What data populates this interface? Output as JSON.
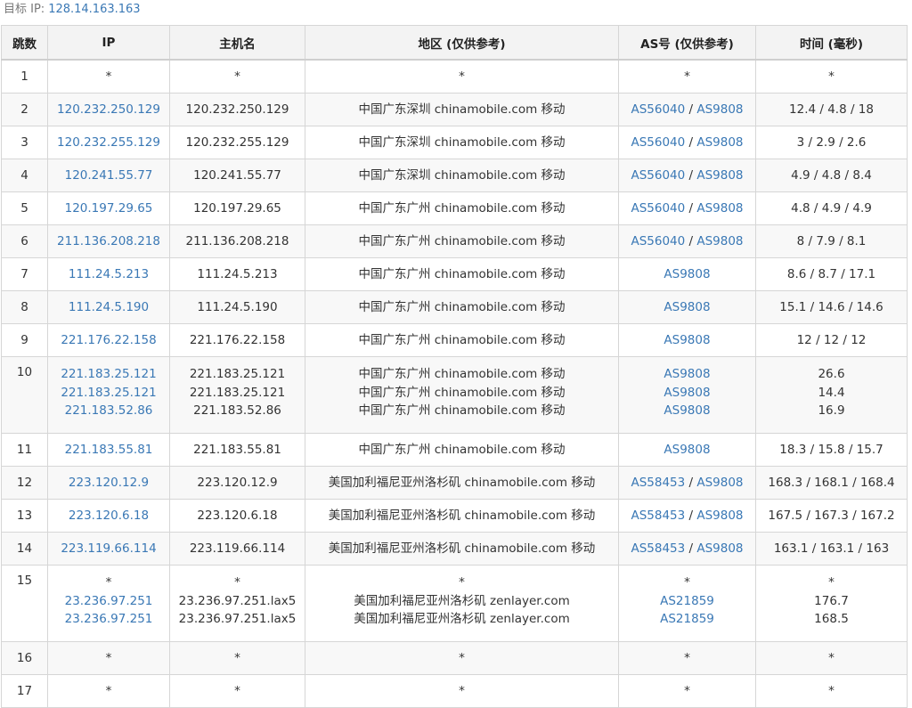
{
  "target": {
    "label": "目标 IP:",
    "ip": "128.14.163.163"
  },
  "columns": [
    "跳数",
    "IP",
    "主机名",
    "地区 (仅供参考)",
    "AS号 (仅供参考)",
    "时间 (毫秒)"
  ],
  "hops": [
    {
      "hop": "1",
      "ips": [
        "*"
      ],
      "hosts": [
        "*"
      ],
      "regions": [
        "*"
      ],
      "as": [
        [
          "*"
        ]
      ],
      "times": [
        "*"
      ]
    },
    {
      "hop": "2",
      "ips": [
        "120.232.250.129"
      ],
      "hosts": [
        "120.232.250.129"
      ],
      "regions": [
        "中国广东深圳 chinamobile.com 移动"
      ],
      "as": [
        [
          "AS56040",
          "AS9808"
        ]
      ],
      "times": [
        "12.4 / 4.8 / 18"
      ]
    },
    {
      "hop": "3",
      "ips": [
        "120.232.255.129"
      ],
      "hosts": [
        "120.232.255.129"
      ],
      "regions": [
        "中国广东深圳 chinamobile.com 移动"
      ],
      "as": [
        [
          "AS56040",
          "AS9808"
        ]
      ],
      "times": [
        "3 / 2.9 / 2.6"
      ]
    },
    {
      "hop": "4",
      "ips": [
        "120.241.55.77"
      ],
      "hosts": [
        "120.241.55.77"
      ],
      "regions": [
        "中国广东深圳 chinamobile.com 移动"
      ],
      "as": [
        [
          "AS56040",
          "AS9808"
        ]
      ],
      "times": [
        "4.9 / 4.8 / 8.4"
      ]
    },
    {
      "hop": "5",
      "ips": [
        "120.197.29.65"
      ],
      "hosts": [
        "120.197.29.65"
      ],
      "regions": [
        "中国广东广州 chinamobile.com 移动"
      ],
      "as": [
        [
          "AS56040",
          "AS9808"
        ]
      ],
      "times": [
        "4.8 / 4.9 / 4.9"
      ]
    },
    {
      "hop": "6",
      "ips": [
        "211.136.208.218"
      ],
      "hosts": [
        "211.136.208.218"
      ],
      "regions": [
        "中国广东广州 chinamobile.com 移动"
      ],
      "as": [
        [
          "AS56040",
          "AS9808"
        ]
      ],
      "times": [
        "8 / 7.9 / 8.1"
      ]
    },
    {
      "hop": "7",
      "ips": [
        "111.24.5.213"
      ],
      "hosts": [
        "111.24.5.213"
      ],
      "regions": [
        "中国广东广州 chinamobile.com 移动"
      ],
      "as": [
        [
          "AS9808"
        ]
      ],
      "times": [
        "8.6 / 8.7 / 17.1"
      ]
    },
    {
      "hop": "8",
      "ips": [
        "111.24.5.190"
      ],
      "hosts": [
        "111.24.5.190"
      ],
      "regions": [
        "中国广东广州 chinamobile.com 移动"
      ],
      "as": [
        [
          "AS9808"
        ]
      ],
      "times": [
        "15.1 / 14.6 / 14.6"
      ]
    },
    {
      "hop": "9",
      "ips": [
        "221.176.22.158"
      ],
      "hosts": [
        "221.176.22.158"
      ],
      "regions": [
        "中国广东广州 chinamobile.com 移动"
      ],
      "as": [
        [
          "AS9808"
        ]
      ],
      "times": [
        "12 / 12 / 12"
      ]
    },
    {
      "hop": "10",
      "ips": [
        "221.183.25.121",
        "221.183.25.121",
        "221.183.52.86"
      ],
      "hosts": [
        "221.183.25.121",
        "221.183.25.121",
        "221.183.52.86"
      ],
      "regions": [
        "中国广东广州 chinamobile.com 移动",
        "中国广东广州 chinamobile.com 移动",
        "中国广东广州 chinamobile.com 移动"
      ],
      "as": [
        [
          "AS9808"
        ],
        [
          "AS9808"
        ],
        [
          "AS9808"
        ]
      ],
      "times": [
        "26.6",
        "14.4",
        "16.9"
      ]
    },
    {
      "hop": "11",
      "ips": [
        "221.183.55.81"
      ],
      "hosts": [
        "221.183.55.81"
      ],
      "regions": [
        "中国广东广州 chinamobile.com 移动"
      ],
      "as": [
        [
          "AS9808"
        ]
      ],
      "times": [
        "18.3 / 15.8 / 15.7"
      ]
    },
    {
      "hop": "12",
      "ips": [
        "223.120.12.9"
      ],
      "hosts": [
        "223.120.12.9"
      ],
      "regions": [
        "美国加利福尼亚州洛杉矶 chinamobile.com 移动"
      ],
      "as": [
        [
          "AS58453",
          "AS9808"
        ]
      ],
      "times": [
        "168.3 / 168.1 / 168.4"
      ]
    },
    {
      "hop": "13",
      "ips": [
        "223.120.6.18"
      ],
      "hosts": [
        "223.120.6.18"
      ],
      "regions": [
        "美国加利福尼亚州洛杉矶 chinamobile.com 移动"
      ],
      "as": [
        [
          "AS58453",
          "AS9808"
        ]
      ],
      "times": [
        "167.5 / 167.3 / 167.2"
      ]
    },
    {
      "hop": "14",
      "ips": [
        "223.119.66.114"
      ],
      "hosts": [
        "223.119.66.114"
      ],
      "regions": [
        "美国加利福尼亚州洛杉矶 chinamobile.com 移动"
      ],
      "as": [
        [
          "AS58453",
          "AS9808"
        ]
      ],
      "times": [
        "163.1 / 163.1 / 163"
      ]
    },
    {
      "hop": "15",
      "ips": [
        "*",
        "23.236.97.251",
        "23.236.97.251"
      ],
      "hosts": [
        "*",
        "23.236.97.251.lax5",
        "23.236.97.251.lax5"
      ],
      "regions": [
        "*",
        "美国加利福尼亚州洛杉矶 zenlayer.com",
        "美国加利福尼亚州洛杉矶 zenlayer.com"
      ],
      "as": [
        [
          "*"
        ],
        [
          "AS21859"
        ],
        [
          "AS21859"
        ]
      ],
      "times": [
        "*",
        "176.7",
        "168.5"
      ]
    },
    {
      "hop": "16",
      "ips": [
        "*"
      ],
      "hosts": [
        "*"
      ],
      "regions": [
        "*"
      ],
      "as": [
        [
          "*"
        ]
      ],
      "times": [
        "*"
      ]
    },
    {
      "hop": "17",
      "ips": [
        "*"
      ],
      "hosts": [
        "*"
      ],
      "regions": [
        "*"
      ],
      "as": [
        [
          "*"
        ]
      ],
      "times": [
        "*"
      ]
    }
  ],
  "colors": {
    "link": "#3a78b5",
    "header_bg": "#f3f3f3",
    "border": "#d6d6d6",
    "zebra": "#f8f8f8"
  }
}
